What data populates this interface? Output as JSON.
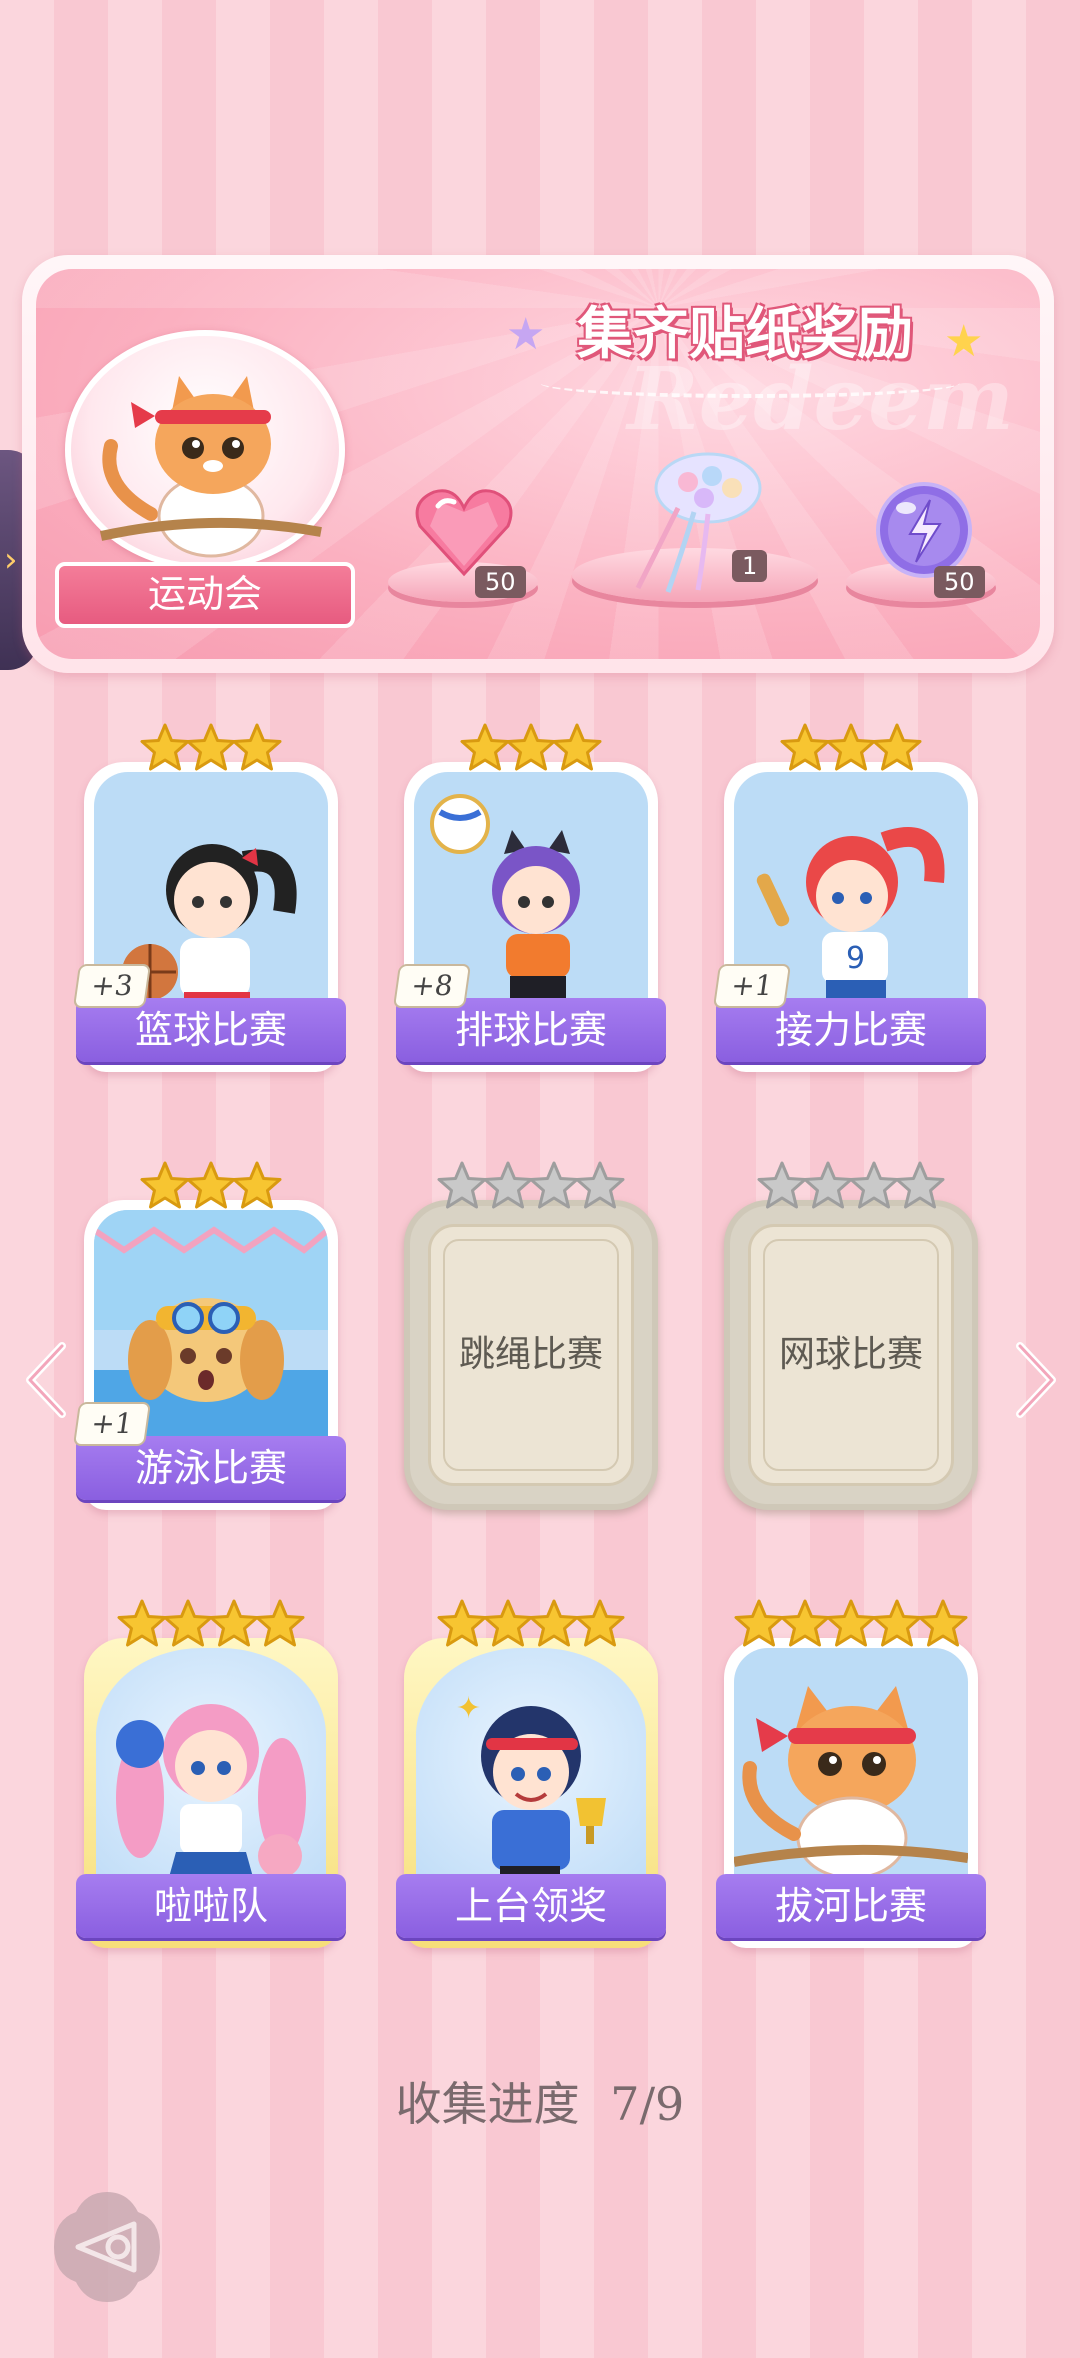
{
  "banner": {
    "title": "集齐贴纸奖励",
    "watermark": "Redeem",
    "event_name": "运动会",
    "rewards": [
      {
        "name": "pink-heart-gem",
        "count": "50"
      },
      {
        "name": "jellyfish-bouquet",
        "count": "1"
      },
      {
        "name": "purple-energy-orb",
        "count": "50"
      }
    ]
  },
  "cards": [
    {
      "name": "篮球比赛",
      "bonus": "+3",
      "stars": 3,
      "stars_total": 3,
      "unlocked": true,
      "gold": false
    },
    {
      "name": "排球比赛",
      "bonus": "+8",
      "stars": 3,
      "stars_total": 3,
      "unlocked": true,
      "gold": false
    },
    {
      "name": "接力比赛",
      "bonus": "+1",
      "stars": 3,
      "stars_total": 3,
      "unlocked": true,
      "gold": false
    },
    {
      "name": "游泳比赛",
      "bonus": "+1",
      "stars": 3,
      "stars_total": 3,
      "unlocked": true,
      "gold": false
    },
    {
      "name": "跳绳比赛",
      "stars": 0,
      "stars_total": 4,
      "unlocked": false
    },
    {
      "name": "网球比赛",
      "stars": 0,
      "stars_total": 4,
      "unlocked": false
    },
    {
      "name": "啦啦队",
      "stars": 4,
      "stars_total": 4,
      "unlocked": true,
      "gold": true
    },
    {
      "name": "上台领奖",
      "stars": 4,
      "stars_total": 4,
      "unlocked": true,
      "gold": true
    },
    {
      "name": "拔河比赛",
      "stars": 5,
      "stars_total": 5,
      "unlocked": true,
      "gold": false
    }
  ],
  "progress": {
    "label": "收集进度",
    "value": "7/9"
  },
  "colors": {
    "background": "#fbd6dd",
    "name_plate": "#8a5fe0",
    "star_gold": "#f7c531",
    "star_gray": "#c9c9c9",
    "banner_pink": "#f79bb0"
  }
}
